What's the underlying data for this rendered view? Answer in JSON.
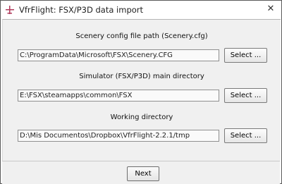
{
  "window": {
    "title": "VfrFlight: FSX/P3D data import",
    "close_glyph": "✕"
  },
  "sections": [
    {
      "label": "Scenery config file path (Scenery.cfg)",
      "value": "C:\\ProgramData\\Microsoft\\FSX\\Scenery.CFG",
      "button": "Select ..."
    },
    {
      "label": "Simulator (FSX/P3D) main directory",
      "value": "E:\\FSX\\steamapps\\common\\FSX",
      "button": "Select ..."
    },
    {
      "label": "Working directory",
      "value": "D:\\Mis Documentos\\Dropbox\\VfrFlight-2.2.1/tmp",
      "button": "Select ..."
    }
  ],
  "footer": {
    "next_label": "Next"
  },
  "icons": {
    "app": "airplane-icon",
    "close": "close-icon"
  },
  "colors": {
    "app_icon": "#b03a5b"
  }
}
